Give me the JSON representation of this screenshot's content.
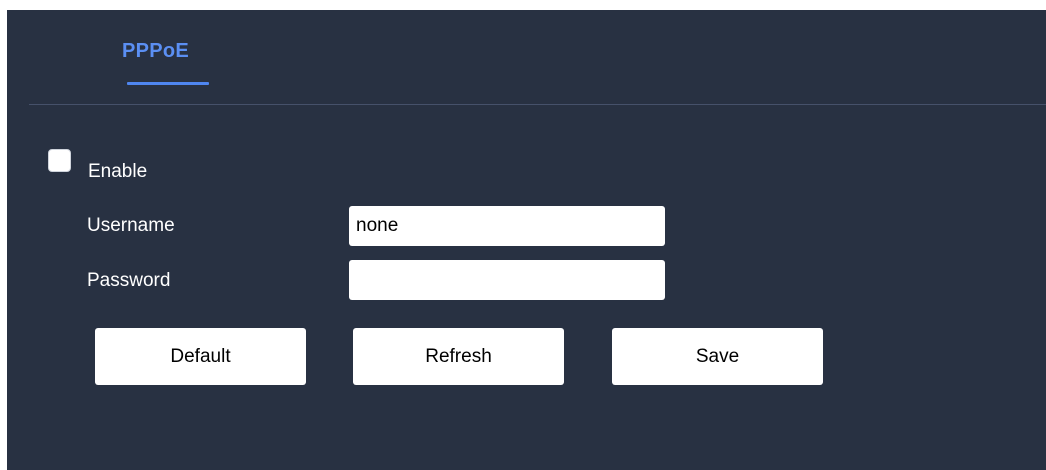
{
  "tabs": [
    {
      "label": "PPPoE",
      "active": true
    }
  ],
  "accent_color": "#4f86f0",
  "panel_background": "#283142",
  "form": {
    "enable": {
      "label": "Enable",
      "checked": false
    },
    "username": {
      "label": "Username",
      "value": "none",
      "placeholder": ""
    },
    "password": {
      "label": "Password",
      "value": "",
      "placeholder": ""
    }
  },
  "buttons": {
    "default_label": "Default",
    "refresh_label": "Refresh",
    "save_label": "Save"
  }
}
